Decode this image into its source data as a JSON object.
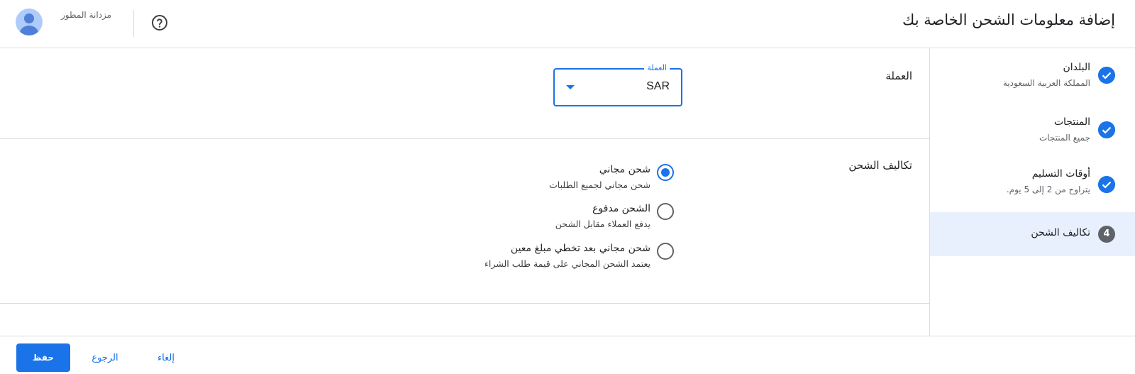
{
  "header": {
    "title": "إضافة معلومات الشحن الخاصة بك",
    "account_name": "مزدانة المطور",
    "help_icon": "help-circle-icon",
    "avatar_icon": "account-avatar-icon"
  },
  "stepper": {
    "steps": [
      {
        "title": "البلدان",
        "subtitle": "المملكة العربية السعودية",
        "status": "complete",
        "icon": "check-circle-icon"
      },
      {
        "title": "المنتجات",
        "subtitle": "جميع المنتجات",
        "status": "complete",
        "icon": "check-circle-icon"
      },
      {
        "title": "أوقات التسليم",
        "subtitle": "يتراوح من 2 إلى 5 يوم.",
        "status": "complete",
        "icon": "check-circle-icon"
      },
      {
        "title": "تكاليف الشحن",
        "subtitle": "",
        "status": "active",
        "number": "4"
      }
    ]
  },
  "currency": {
    "label": "العملة",
    "field_label": "العملة",
    "value": "SAR"
  },
  "shipping_costs": {
    "label": "تكاليف الشحن",
    "options": [
      {
        "title": "شحن مجاني",
        "subtitle": "شحن مجاني لجميع الطلبات",
        "selected": true
      },
      {
        "title": "الشحن مدفوع",
        "subtitle": "يدفع العملاء مقابل الشحن",
        "selected": false
      },
      {
        "title": "شحن مجاني بعد تخطي مبلغ معين",
        "subtitle": "يعتمد الشحن المجاني على قيمة طلب الشراء",
        "selected": false
      }
    ]
  },
  "footer": {
    "save_label": "حفظ",
    "back_label": "الرجوع",
    "cancel_label": "إلغاء"
  },
  "colors": {
    "accent": "#1a73e8",
    "active_step_bg": "#e8f0fe",
    "divider": "#dadce0"
  }
}
